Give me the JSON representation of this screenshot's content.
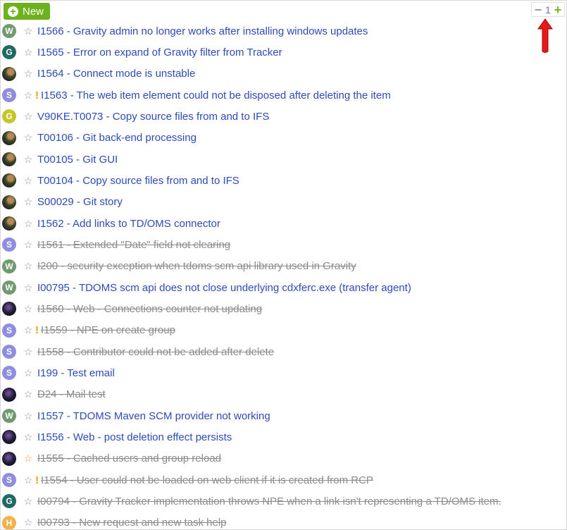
{
  "toolbar": {
    "new_label": "New",
    "zoom_value": "1"
  },
  "items": [
    {
      "avatar": "W",
      "av": "av-W",
      "text": "I1566 - Gravity admin no longer works after installing windows updates",
      "done": false,
      "prio": false,
      "star": "gray"
    },
    {
      "avatar": "G",
      "av": "av-G",
      "text": "I1565 - Error on expand of Gravity filter from Tracker",
      "done": false,
      "prio": false,
      "star": "gray"
    },
    {
      "avatar": "",
      "av": "av-photo",
      "text": "I1564 - Connect mode is unstable",
      "done": false,
      "prio": false,
      "star": "gray"
    },
    {
      "avatar": "S",
      "av": "av-S",
      "text": "I1563 - The web item element could not be disposed after deleting the item",
      "done": false,
      "prio": true,
      "star": "gray"
    },
    {
      "avatar": "G",
      "av": "av-Y",
      "text": "V90KE.T0073 - Copy source files from and to IFS",
      "done": false,
      "prio": false,
      "star": "gray"
    },
    {
      "avatar": "",
      "av": "av-photo",
      "text": "T00106 - Git back-end processing",
      "done": false,
      "prio": false,
      "star": "gray"
    },
    {
      "avatar": "",
      "av": "av-photo",
      "text": "T00105 - Git GUI",
      "done": false,
      "prio": false,
      "star": "gray"
    },
    {
      "avatar": "",
      "av": "av-photo",
      "text": "T00104 - Copy source files from and to IFS",
      "done": false,
      "prio": false,
      "star": "gray"
    },
    {
      "avatar": "",
      "av": "av-photo",
      "text": "S00029 - Git story",
      "done": false,
      "prio": false,
      "star": "gray"
    },
    {
      "avatar": "",
      "av": "av-photo",
      "text": "I1562 - Add links to TD/OMS connector",
      "done": false,
      "prio": false,
      "star": "gray"
    },
    {
      "avatar": "S",
      "av": "av-S",
      "text": "I1561 - Extended \"Date\" field not clearing",
      "done": true,
      "prio": false,
      "star": "gray"
    },
    {
      "avatar": "W",
      "av": "av-W",
      "text": "I200 - security exception when tdoms scm api library used in Gravity",
      "done": true,
      "prio": false,
      "star": "gray"
    },
    {
      "avatar": "W",
      "av": "av-W",
      "text": "I00795 - TDOMS scm api does not close underlying cdxferc.exe (transfer agent)",
      "done": false,
      "prio": false,
      "star": "gray"
    },
    {
      "avatar": "",
      "av": "av-space",
      "text": "I1560 - Web - Connections counter not updating",
      "done": true,
      "prio": false,
      "star": "gray"
    },
    {
      "avatar": "S",
      "av": "av-S",
      "text": "I1559 - NPE on create group",
      "done": true,
      "prio": true,
      "star": "gray"
    },
    {
      "avatar": "S",
      "av": "av-S",
      "text": "I1558 - Contributor could not be added after delete",
      "done": true,
      "prio": false,
      "star": "gray"
    },
    {
      "avatar": "S",
      "av": "av-S",
      "text": "I199 - Test email",
      "done": false,
      "prio": false,
      "star": "gray"
    },
    {
      "avatar": "",
      "av": "av-space",
      "text": "D24 - Mail test",
      "done": true,
      "prio": false,
      "star": "gray"
    },
    {
      "avatar": "W",
      "av": "av-W",
      "text": "I1557 - TDOMS Maven SCM provider not working",
      "done": false,
      "prio": false,
      "star": "gray"
    },
    {
      "avatar": "",
      "av": "av-space",
      "text": "I1556 - Web - post deletion effect persists",
      "done": false,
      "prio": false,
      "star": "gray"
    },
    {
      "avatar": "",
      "av": "av-space",
      "text": "I1555 - Cached users and group reload",
      "done": true,
      "prio": false,
      "star": "gold"
    },
    {
      "avatar": "S",
      "av": "av-S",
      "text": "I1554 - User could not be loaded on web client if it is created from RCP",
      "done": true,
      "prio": true,
      "star": "gray"
    },
    {
      "avatar": "G",
      "av": "av-G",
      "text": "I00794 - Gravity Tracker implementation throws NPE when a link isn't representing a TD/OMS item.",
      "done": true,
      "prio": false,
      "star": "gray"
    },
    {
      "avatar": "H",
      "av": "av-H",
      "text": "I00793 - New request and new task help",
      "done": true,
      "prio": false,
      "star": "gray"
    }
  ]
}
